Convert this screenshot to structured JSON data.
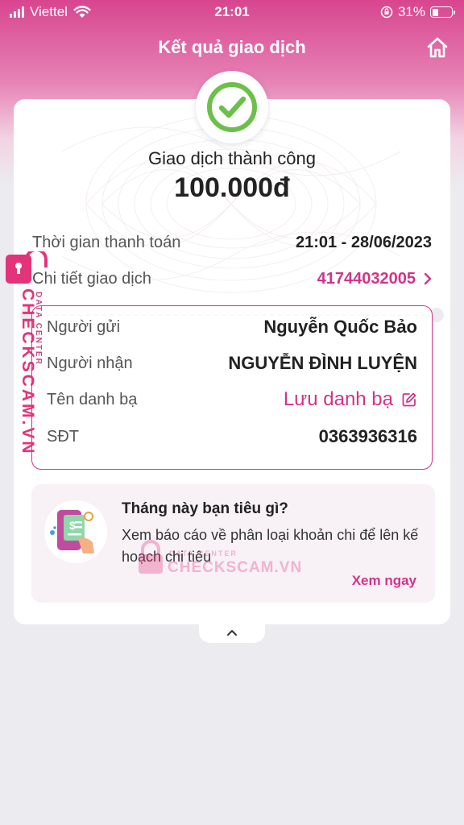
{
  "status_bar": {
    "carrier": "Viettel",
    "time": "21:01",
    "battery": "31%",
    "battery_level": 0.31
  },
  "header": {
    "title": "Kết quả giao dịch"
  },
  "result": {
    "status": "Giao dịch thành công",
    "amount": "100.000đ"
  },
  "details": {
    "time_label": "Thời gian thanh toán",
    "time_value": "21:01 - 28/06/2023",
    "detail_label": "Chi tiết giao dịch",
    "detail_value": "41744032005"
  },
  "parties": {
    "sender_label": "Người gửi",
    "sender_value": "Nguyễn Quốc Bảo",
    "receiver_label": "Người nhận",
    "receiver_value": "NGUYỄN ĐÌNH LUYỆN",
    "contact_label": "Tên danh bạ",
    "contact_action": "Lưu danh bạ",
    "phone_label": "SĐT",
    "phone_value": "0363936316"
  },
  "promo": {
    "title": "Tháng này bạn tiêu gì?",
    "description": "Xem báo cáo về phân loại khoản chi để lên kế hoạch chi tiêu",
    "link": "Xem ngay"
  },
  "watermark": {
    "brand": "CHECKSCAM.VN",
    "sub": "DATA CENTER"
  },
  "colors": {
    "accent": "#d2338a",
    "success": "#6cc04a",
    "watermark": "#e3337a"
  }
}
